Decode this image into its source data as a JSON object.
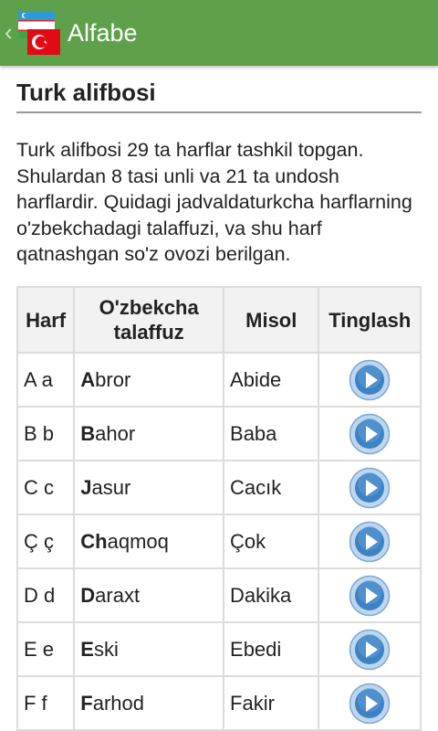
{
  "appbar": {
    "title": "Alfabe",
    "back_icon": "chevron-left-icon",
    "logo_icon": "uzbek-turkish-flags-icon"
  },
  "page": {
    "title": "Turk alifbosi",
    "intro": "Turk alifbosi 29 ta harflar tashkil topgan. Shulardan 8 tasi unli va 21 ta undosh harflardir. Quidagi jadvaldaturkcha harflarning o'zbekchadagi talaffuzi, va shu harf qatnashgan so'z ovozi berilgan."
  },
  "table": {
    "headers": [
      "Harf",
      "O'zbekcha talaffuz",
      "Misol",
      "Tinglash"
    ],
    "rows": [
      {
        "harf": "A a",
        "uz_bold": "A",
        "uz_rest": "bror",
        "misol": "Abide"
      },
      {
        "harf": "B b",
        "uz_bold": "B",
        "uz_rest": "ahor",
        "misol": "Baba"
      },
      {
        "harf": "C c",
        "uz_bold": "J",
        "uz_rest": "asur",
        "misol": "Cacık"
      },
      {
        "harf": "Ç ç",
        "uz_bold": "Ch",
        "uz_rest": "aqmoq",
        "misol": "Çok"
      },
      {
        "harf": "D d",
        "uz_bold": "D",
        "uz_rest": "araxt",
        "misol": "Dakika"
      },
      {
        "harf": "E e",
        "uz_bold": "E",
        "uz_rest": "ski",
        "misol": "Ebedi"
      },
      {
        "harf": "F f",
        "uz_bold": "F",
        "uz_rest": "arhod",
        "misol": "Fakir"
      }
    ],
    "play_icon": "play-icon"
  },
  "colors": {
    "appbar": "#5ea14a",
    "play_blue": "#3d82c4"
  }
}
